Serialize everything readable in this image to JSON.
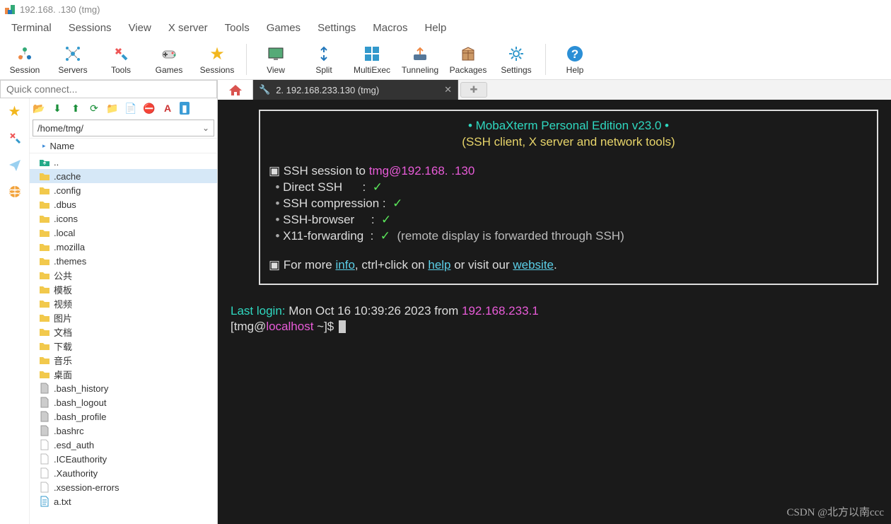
{
  "title": "192.168.    .130 (tmg)",
  "menu": [
    "Terminal",
    "Sessions",
    "View",
    "X server",
    "Tools",
    "Games",
    "Settings",
    "Macros",
    "Help"
  ],
  "toolbar": [
    {
      "label": "Session",
      "icon": "session"
    },
    {
      "label": "Servers",
      "icon": "servers"
    },
    {
      "label": "Tools",
      "icon": "tools"
    },
    {
      "label": "Games",
      "icon": "games"
    },
    {
      "label": "Sessions",
      "icon": "star"
    },
    {
      "label": "View",
      "icon": "view"
    },
    {
      "label": "Split",
      "icon": "split"
    },
    {
      "label": "MultiExec",
      "icon": "multiexec"
    },
    {
      "label": "Tunneling",
      "icon": "tunneling"
    },
    {
      "label": "Packages",
      "icon": "packages"
    },
    {
      "label": "Settings",
      "icon": "settings"
    },
    {
      "label": "Help",
      "icon": "help"
    }
  ],
  "quick_placeholder": "Quick connect...",
  "path": "/home/tmg/",
  "col_header": "Name",
  "files": [
    {
      "name": "..",
      "type": "up"
    },
    {
      "name": ".cache",
      "type": "folder",
      "sel": true
    },
    {
      "name": ".config",
      "type": "folder"
    },
    {
      "name": ".dbus",
      "type": "folder"
    },
    {
      "name": ".icons",
      "type": "folder"
    },
    {
      "name": ".local",
      "type": "folder"
    },
    {
      "name": ".mozilla",
      "type": "folder"
    },
    {
      "name": ".themes",
      "type": "folder"
    },
    {
      "name": "公共",
      "type": "folder"
    },
    {
      "name": "模板",
      "type": "folder"
    },
    {
      "name": "视频",
      "type": "folder"
    },
    {
      "name": "图片",
      "type": "folder"
    },
    {
      "name": "文档",
      "type": "folder"
    },
    {
      "name": "下载",
      "type": "folder"
    },
    {
      "name": "音乐",
      "type": "folder"
    },
    {
      "name": "桌面",
      "type": "folder"
    },
    {
      "name": ".bash_history",
      "type": "file-gray"
    },
    {
      "name": ".bash_logout",
      "type": "file-gray"
    },
    {
      "name": ".bash_profile",
      "type": "file-gray"
    },
    {
      "name": ".bashrc",
      "type": "file-gray"
    },
    {
      "name": ".esd_auth",
      "type": "file"
    },
    {
      "name": ".ICEauthority",
      "type": "file"
    },
    {
      "name": ".Xauthority",
      "type": "file"
    },
    {
      "name": ".xsession-errors",
      "type": "file"
    },
    {
      "name": "a.txt",
      "type": "file-txt"
    }
  ],
  "tab_label": "2. 192.168.233.130 (tmg)",
  "term": {
    "banner1": "• MobaXterm Personal Edition v23.0 •",
    "banner2": "(SSH client, X server and network tools)",
    "sshto_a": "SSH session to ",
    "sshto_b": "tmg@192.168.   .130",
    "l1": "Direct SSH",
    "l2": "SSH compression",
    "l3": "SSH-browser",
    "l4": "X11-forwarding",
    "l4_note": "(remote display is forwarded through SSH)",
    "info_a": "For more ",
    "info_b": "info",
    "info_c": ", ctrl+click on ",
    "info_d": "help",
    "info_e": " or visit our ",
    "info_f": "website",
    "login_a": "Last login:",
    "login_b": " Mon Oct 16 10:39:26 2023 from ",
    "login_c": "192.168.233.1",
    "prompt_a": "[tmg@",
    "prompt_b": "localhost",
    "prompt_c": " ~]$ "
  },
  "watermark": "CSDN @北方以南ccc"
}
